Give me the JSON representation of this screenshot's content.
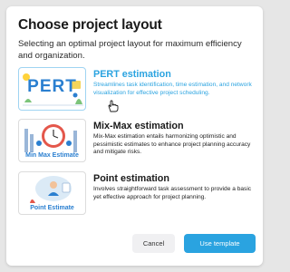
{
  "dialog": {
    "title": "Choose project layout",
    "subtitle": "Selecting an optimal project layout for maximum efficiency and organization."
  },
  "options": [
    {
      "title": "PERT estimation",
      "description": "Streamlines task identification, time estimation, and network visualization for effective project scheduling.",
      "thumb_text": "PERT",
      "selected": true
    },
    {
      "title": "Mix-Max estimation",
      "description": "Mix-Max estimation entails harmonizing optimistic and pessimistic estimates to enhance project planning accuracy and mitigate risks.",
      "thumb_text": "Min Max Estimate",
      "selected": false
    },
    {
      "title": "Point estimation",
      "description": "Involves straightforward task assessment to provide a basic yet effective approach for project planning.",
      "thumb_text": "Point Estimate",
      "selected": false
    }
  ],
  "buttons": {
    "cancel": "Cancel",
    "use": "Use template"
  },
  "colors": {
    "accent": "#2aa3e0",
    "overlay": "#e6e6e6"
  }
}
